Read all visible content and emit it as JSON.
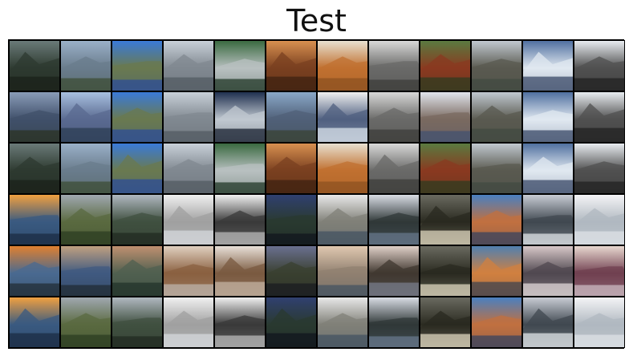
{
  "title": "Test",
  "grid": {
    "rows": 6,
    "cols": 12,
    "tiles": [
      [
        "mountain-valley-dark",
        "mountain-forest",
        "lake-blue-sky",
        "cloudy-sky",
        "rock-lake-green",
        "canyon-sunset",
        "autumn-forest-poster",
        "cliff-grey",
        "sequoia-forest",
        "lake-reflection",
        "river-snow",
        "waterfall-ice"
      ],
      [
        "mountain-valley-blue",
        "mountain-forest-blue",
        "lake-blue-sky",
        "cloudy-sky",
        "rock-lake-blue",
        "canyon-blue",
        "snow-forest-poster",
        "cliff-grey",
        "sequoia-snow",
        "lake-reflection",
        "river-snow",
        "waterfall-ice"
      ],
      [
        "mountain-valley-dark",
        "mountain-forest",
        "lake-blue-sky",
        "cloudy-sky",
        "rock-lake-green",
        "canyon-sunset",
        "autumn-forest-poster",
        "cliff-grey",
        "sequoia-forest",
        "lake-reflection",
        "river-snow",
        "waterfall-ice"
      ],
      [
        "sunset-dome",
        "valley-panorama",
        "forest-mountain",
        "snow-field",
        "snow-rocks",
        "river-night",
        "el-capitan-snow",
        "snow-forest-river",
        "framed-dark-forest",
        "river-sunset",
        "snow-valley",
        "snow-drift"
      ],
      [
        "sunset-dome-warm",
        "valley-panorama-warm",
        "forest-mountain-warm",
        "snow-field-warm",
        "snow-rocks-warm",
        "river-night-warm",
        "el-capitan-warm",
        "snow-forest-warm",
        "framed-dark-forest",
        "river-sunset-warm",
        "snow-valley-warm",
        "snow-drift-warm"
      ],
      [
        "sunset-dome",
        "valley-panorama",
        "forest-mountain",
        "snow-field",
        "snow-rocks",
        "river-night",
        "el-capitan-snow",
        "snow-forest-river",
        "framed-dark-forest",
        "river-sunset",
        "snow-valley",
        "snow-drift"
      ]
    ]
  }
}
